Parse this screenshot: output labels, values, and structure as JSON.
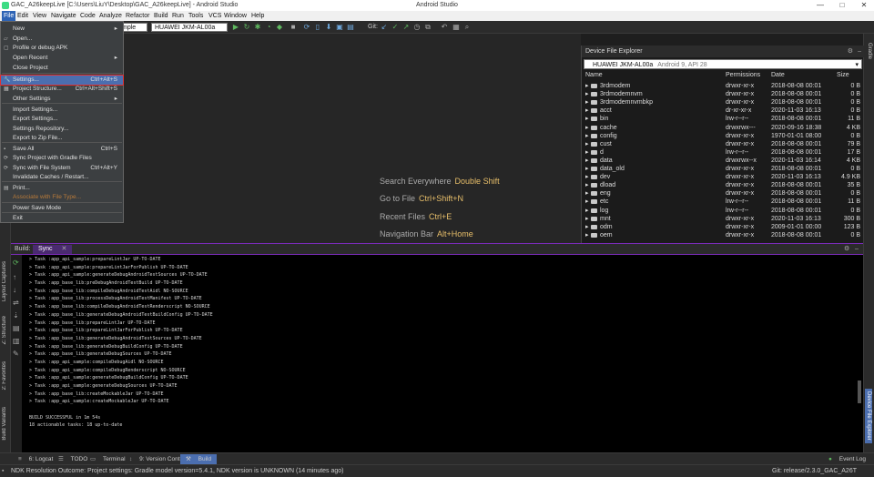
{
  "window": {
    "title": "GAC_A26keepLive [C:\\Users\\LiuY\\Desktop\\GAC_A26keepLive] - Android Studio",
    "app_name": "Android Studio",
    "min": "—",
    "max": "□",
    "close": "✕"
  },
  "menubar": [
    "File",
    "Edit",
    "View",
    "Navigate",
    "Code",
    "Analyze",
    "Refactor",
    "Build",
    "Run",
    "Tools",
    "VCS",
    "Window",
    "Help"
  ],
  "toolbar": {
    "config_combo": "mple",
    "device_combo": "HUAWEI JKM-AL00a",
    "git_label": "Git:"
  },
  "file_menu": {
    "items": [
      {
        "label": "New",
        "shortcut": "",
        "submenu": true
      },
      {
        "label": "Open...",
        "shortcut": ""
      },
      {
        "label": "Profile or debug APK",
        "shortcut": ""
      },
      {
        "label": "Open Recent",
        "shortcut": "",
        "submenu": true
      },
      {
        "label": "Close Project",
        "shortcut": ""
      },
      {
        "label": "Settings...",
        "shortcut": "Ctrl+Alt+S"
      },
      {
        "label": "Project Structure...",
        "shortcut": "Ctrl+Alt+Shift+S"
      },
      {
        "label": "Other Settings",
        "shortcut": "",
        "submenu": true
      },
      {
        "label": "Import Settings...",
        "shortcut": ""
      },
      {
        "label": "Export Settings...",
        "shortcut": ""
      },
      {
        "label": "Settings Repository...",
        "shortcut": ""
      },
      {
        "label": "Export to Zip File...",
        "shortcut": ""
      },
      {
        "label": "Save All",
        "shortcut": "Ctrl+S"
      },
      {
        "label": "Sync Project with Gradle Files",
        "shortcut": ""
      },
      {
        "label": "Sync with File System",
        "shortcut": "Ctrl+Alt+Y"
      },
      {
        "label": "Invalidate Caches / Restart...",
        "shortcut": ""
      },
      {
        "label": "Print...",
        "shortcut": ""
      },
      {
        "label": "Associate with File Type...",
        "shortcut": ""
      },
      {
        "label": "Power Save Mode",
        "shortcut": ""
      },
      {
        "label": "Exit",
        "shortcut": ""
      }
    ]
  },
  "editor_hints": [
    {
      "label": "Search Everywhere",
      "key": "Double Shift"
    },
    {
      "label": "Go to File",
      "key": "Ctrl+Shift+N"
    },
    {
      "label": "Recent Files",
      "key": "Ctrl+E"
    },
    {
      "label": "Navigation Bar",
      "key": "Alt+Home"
    }
  ],
  "device_explorer": {
    "title": "Device File Explorer",
    "device": "HUAWEI JKM-AL00a",
    "device_info": "Android 9, API 28",
    "columns": [
      "Name",
      "Permissions",
      "Date",
      "Size"
    ],
    "rows": [
      {
        "name": "3rdmodem",
        "perm": "drwxr-xr-x",
        "date": "2018-08-08 00:01",
        "size": "0 B"
      },
      {
        "name": "3rdmodemnvm",
        "perm": "drwxr-xr-x",
        "date": "2018-08-08 00:01",
        "size": "0 B"
      },
      {
        "name": "3rdmodemnvmbkp",
        "perm": "drwxr-xr-x",
        "date": "2018-08-08 00:01",
        "size": "0 B"
      },
      {
        "name": "acct",
        "perm": "dr-xr-xr-x",
        "date": "2020-11-03 16:13",
        "size": "0 B"
      },
      {
        "name": "bin",
        "perm": "lrw-r--r--",
        "date": "2018-08-08 00:01",
        "size": "11 B"
      },
      {
        "name": "cache",
        "perm": "drwxrwx---",
        "date": "2020-09-16 18:38",
        "size": "4 KB"
      },
      {
        "name": "config",
        "perm": "drwxr-xr-x",
        "date": "1970-01-01 08:00",
        "size": "0 B"
      },
      {
        "name": "cust",
        "perm": "drwxr-xr-x",
        "date": "2018-08-08 00:01",
        "size": "79 B"
      },
      {
        "name": "d",
        "perm": "lrw-r--r--",
        "date": "2018-08-08 00:01",
        "size": "17 B"
      },
      {
        "name": "data",
        "perm": "drwxrwx--x",
        "date": "2020-11-03 16:14",
        "size": "4 KB"
      },
      {
        "name": "data_old",
        "perm": "drwxr-xr-x",
        "date": "2018-08-08 00:01",
        "size": "0 B"
      },
      {
        "name": "dev",
        "perm": "drwxr-xr-x",
        "date": "2020-11-03 16:13",
        "size": "4.9 KB"
      },
      {
        "name": "dload",
        "perm": "drwxr-xr-x",
        "date": "2018-08-08 00:01",
        "size": "35 B"
      },
      {
        "name": "eng",
        "perm": "drwxr-xr-x",
        "date": "2018-08-08 00:01",
        "size": "0 B"
      },
      {
        "name": "etc",
        "perm": "lrw-r--r--",
        "date": "2018-08-08 00:01",
        "size": "11 B"
      },
      {
        "name": "log",
        "perm": "lrw-r--r--",
        "date": "2018-08-08 00:01",
        "size": "0 B"
      },
      {
        "name": "mnt",
        "perm": "drwxr-xr-x",
        "date": "2020-11-03 16:13",
        "size": "300 B"
      },
      {
        "name": "odm",
        "perm": "drwxr-xr-x",
        "date": "2009-01-01 00:00",
        "size": "123 B"
      },
      {
        "name": "oem",
        "perm": "drwxr-xr-x",
        "date": "2018-08-08 00:01",
        "size": "0 B"
      }
    ]
  },
  "build_panel": {
    "tab_build": "Build:",
    "tab_sync": "Sync",
    "log": [
      "> Task :app_api_sample:prepareLintJar UP-TO-DATE",
      "> Task :app_api_sample:prepareLintJarForPublish UP-TO-DATE",
      "> Task :app_api_sample:generateDebugAndroidTestSources UP-TO-DATE",
      "> Task :app_base_lib:preDebugAndroidTestBuild UP-TO-DATE",
      "> Task :app_base_lib:compileDebugAndroidTestAidl NO-SOURCE",
      "> Task :app_base_lib:processDebugAndroidTestManifest UP-TO-DATE",
      "> Task :app_base_lib:compileDebugAndroidTestRenderscript NO-SOURCE",
      "> Task :app_base_lib:generateDebugAndroidTestBuildConfig UP-TO-DATE",
      "> Task :app_base_lib:prepareLintJar UP-TO-DATE",
      "> Task :app_base_lib:prepareLintJarForPublish UP-TO-DATE",
      "> Task :app_base_lib:generateDebugAndroidTestSources UP-TO-DATE",
      "> Task :app_base_lib:generateDebugBuildConfig UP-TO-DATE",
      "> Task :app_base_lib:generateDebugSources UP-TO-DATE",
      "> Task :app_api_sample:compileDebugAidl NO-SOURCE",
      "> Task :app_api_sample:compileDebugRenderscript NO-SOURCE",
      "> Task :app_api_sample:generateDebugBuildConfig UP-TO-DATE",
      "> Task :app_api_sample:generateDebugSources UP-TO-DATE",
      "> Task :app_base_lib:createMockableJar UP-TO-DATE",
      "> Task :app_api_sample:createMockableJar UP-TO-DATE",
      "",
      "BUILD SUCCESSFUL in 1m 54s",
      "18 actionable tasks: 18 up-to-date"
    ]
  },
  "side_labels": {
    "left": [
      "Layout Captures",
      "Z: Structure",
      "2: Favorites",
      "Build Variants"
    ],
    "right": [
      "Gradle",
      "Device File Explorer"
    ]
  },
  "bottom_tabs": [
    "6: Logcat",
    "TODO",
    "Terminal",
    "9: Version Control",
    "Build"
  ],
  "event_log": "Event Log",
  "status": {
    "message": "NDK Resolution Outcome: Project settings: Gradle model version=5.4.1, NDK version is UNKNOWN (14 minutes ago)",
    "git": "Git: release/2.3.0_GAC_A26T"
  },
  "colors": {
    "accent": "#7a2bb8",
    "highlight": "#e03030",
    "menu_bg": "#3c3f41",
    "selection": "#4b6eaf"
  }
}
